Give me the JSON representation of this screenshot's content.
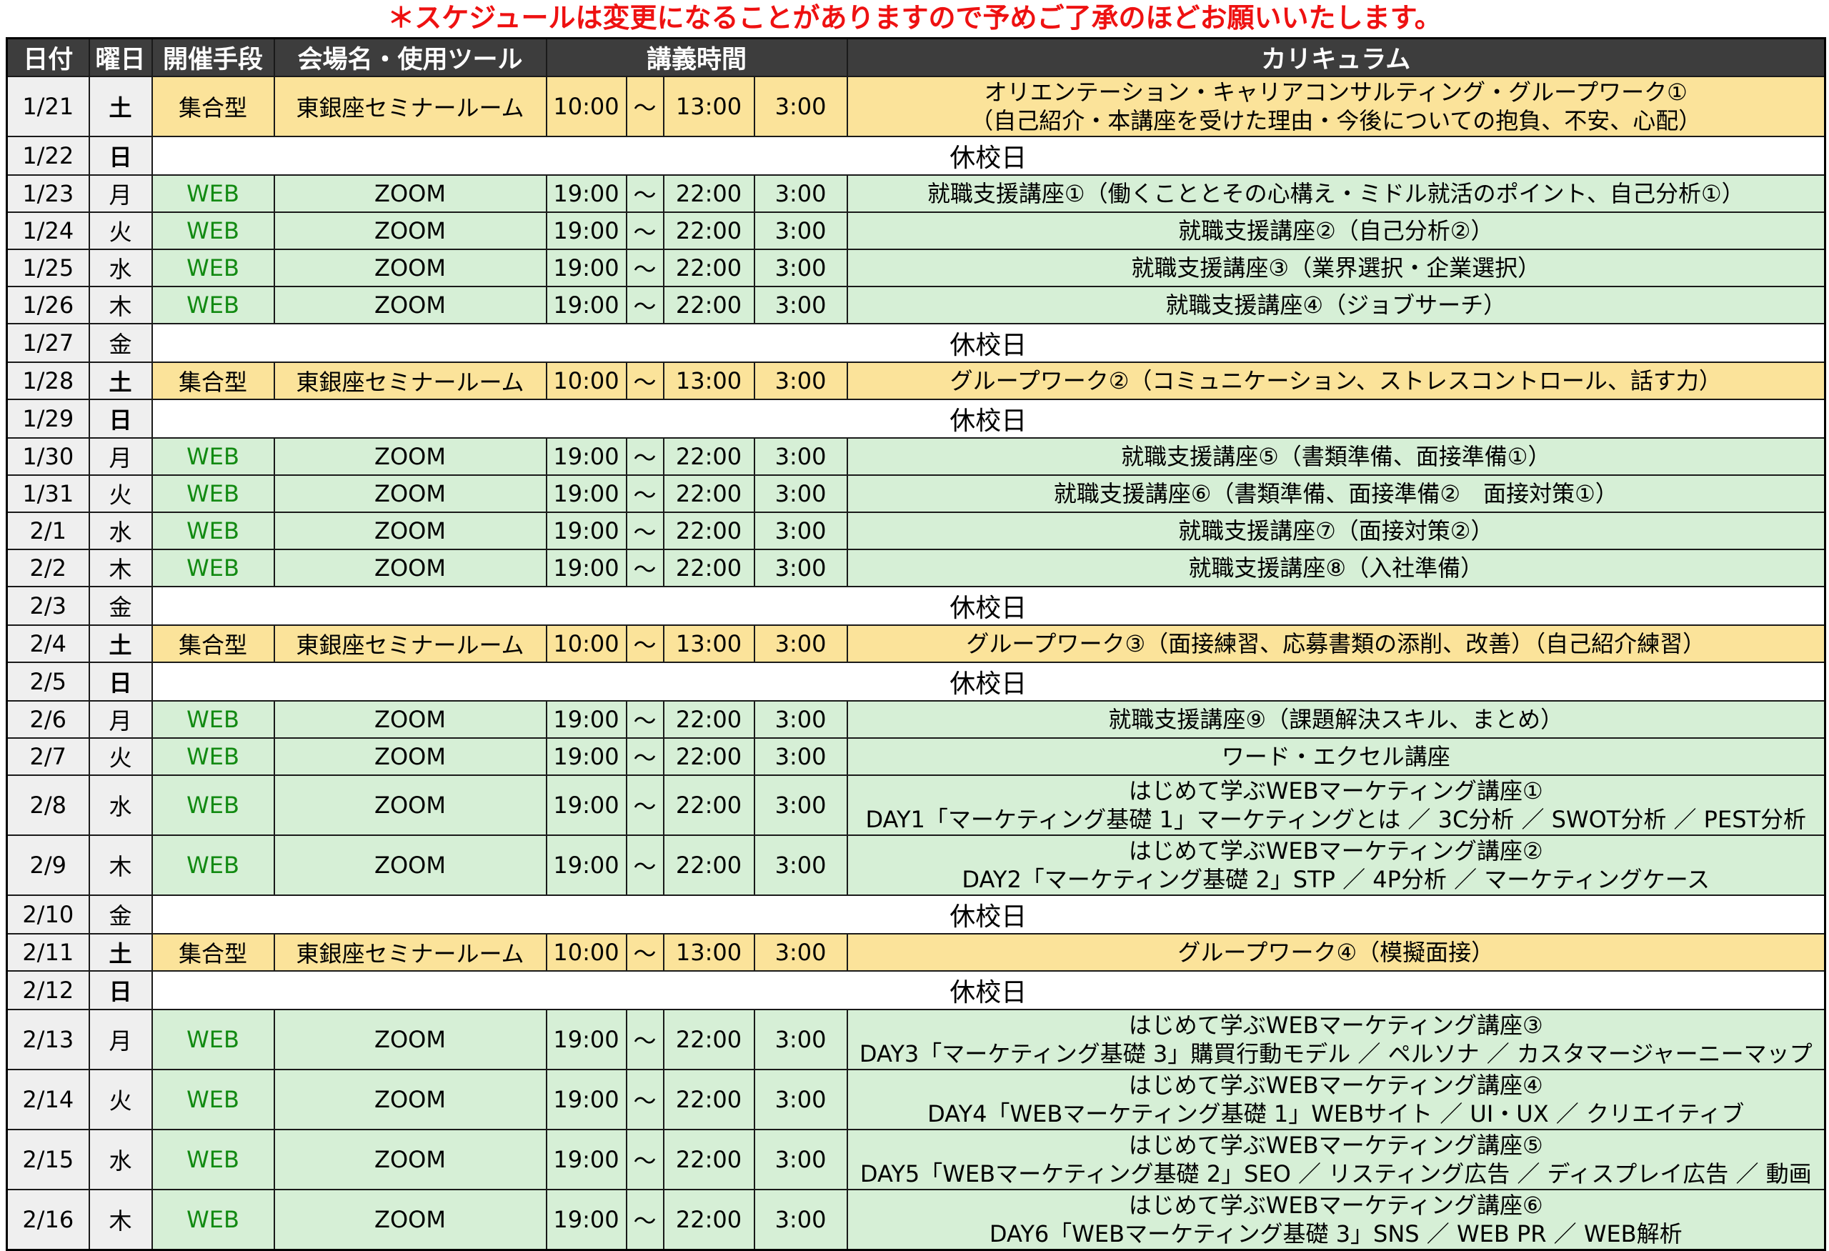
{
  "notice": "＊スケジュールは変更になることがありますので予めご了承のほどお願いいたします。",
  "headers": {
    "date": "日付",
    "day": "曜日",
    "method": "開催手段",
    "venue": "会場名・使用ツール",
    "time": "講義時間",
    "curriculum": "カリキュラム"
  },
  "holiday_label": "休校日",
  "rows": [
    {
      "date": "1/21",
      "day": "土",
      "kind": "live",
      "method": "集合型",
      "venue": "東銀座セミナールーム",
      "start": "10:00",
      "sep": "～",
      "end": "13:00",
      "dur": "3:00",
      "curriculum": [
        "オリエンテーション・キャリアコンサルティング・グループワーク①",
        "（自己紹介・本講座を受けた理由・今後についての抱負、不安、心配）"
      ],
      "color": "black"
    },
    {
      "date": "1/22",
      "day": "日",
      "kind": "holiday"
    },
    {
      "date": "1/23",
      "day": "月",
      "kind": "web",
      "method": "WEB",
      "venue": "ZOOM",
      "start": "19:00",
      "sep": "～",
      "end": "22:00",
      "dur": "3:00",
      "curriculum": [
        "就職支援講座①（働くこととその心構え・ミドル就活のポイント、自己分析①）"
      ],
      "color": "black"
    },
    {
      "date": "1/24",
      "day": "火",
      "kind": "web",
      "method": "WEB",
      "venue": "ZOOM",
      "start": "19:00",
      "sep": "～",
      "end": "22:00",
      "dur": "3:00",
      "curriculum": [
        "就職支援講座②（自己分析②）"
      ],
      "color": "black"
    },
    {
      "date": "1/25",
      "day": "水",
      "kind": "web",
      "method": "WEB",
      "venue": "ZOOM",
      "start": "19:00",
      "sep": "～",
      "end": "22:00",
      "dur": "3:00",
      "curriculum": [
        "就職支援講座③（業界選択・企業選択）"
      ],
      "color": "black"
    },
    {
      "date": "1/26",
      "day": "木",
      "kind": "web",
      "method": "WEB",
      "venue": "ZOOM",
      "start": "19:00",
      "sep": "～",
      "end": "22:00",
      "dur": "3:00",
      "curriculum": [
        "就職支援講座④（ジョブサーチ）"
      ],
      "color": "black"
    },
    {
      "date": "1/27",
      "day": "金",
      "kind": "holiday"
    },
    {
      "date": "1/28",
      "day": "土",
      "kind": "live",
      "method": "集合型",
      "venue": "東銀座セミナールーム",
      "start": "10:00",
      "sep": "～",
      "end": "13:00",
      "dur": "3:00",
      "curriculum": [
        "グループワーク②（コミュニケーション、ストレスコントロール、話す力）"
      ],
      "color": "black"
    },
    {
      "date": "1/29",
      "day": "日",
      "kind": "holiday"
    },
    {
      "date": "1/30",
      "day": "月",
      "kind": "web",
      "method": "WEB",
      "venue": "ZOOM",
      "start": "19:00",
      "sep": "～",
      "end": "22:00",
      "dur": "3:00",
      "curriculum": [
        "就職支援講座⑤（書類準備、面接準備①）"
      ],
      "color": "black"
    },
    {
      "date": "1/31",
      "day": "火",
      "kind": "web",
      "method": "WEB",
      "venue": "ZOOM",
      "start": "19:00",
      "sep": "～",
      "end": "22:00",
      "dur": "3:00",
      "curriculum": [
        "就職支援講座⑥（書類準備、面接準備②　面接対策①）"
      ],
      "color": "black"
    },
    {
      "date": "2/1",
      "day": "水",
      "kind": "web",
      "method": "WEB",
      "venue": "ZOOM",
      "start": "19:00",
      "sep": "～",
      "end": "22:00",
      "dur": "3:00",
      "curriculum": [
        "就職支援講座⑦（面接対策②）"
      ],
      "color": "black"
    },
    {
      "date": "2/2",
      "day": "木",
      "kind": "web",
      "method": "WEB",
      "venue": "ZOOM",
      "start": "19:00",
      "sep": "～",
      "end": "22:00",
      "dur": "3:00",
      "curriculum": [
        "就職支援講座⑧（入社準備）"
      ],
      "color": "black"
    },
    {
      "date": "2/3",
      "day": "金",
      "kind": "holiday"
    },
    {
      "date": "2/4",
      "day": "土",
      "kind": "live",
      "method": "集合型",
      "venue": "東銀座セミナールーム",
      "start": "10:00",
      "sep": "～",
      "end": "13:00",
      "dur": "3:00",
      "curriculum": [
        "グループワーク③（面接練習、応募書類の添削、改善）（自己紹介練習）"
      ],
      "color": "black"
    },
    {
      "date": "2/5",
      "day": "日",
      "kind": "holiday"
    },
    {
      "date": "2/6",
      "day": "月",
      "kind": "web",
      "method": "WEB",
      "venue": "ZOOM",
      "start": "19:00",
      "sep": "～",
      "end": "22:00",
      "dur": "3:00",
      "curriculum": [
        "就職支援講座⑨（課題解決スキル、まとめ）"
      ],
      "color": "black"
    },
    {
      "date": "2/7",
      "day": "火",
      "kind": "web",
      "method": "WEB",
      "venue": "ZOOM",
      "start": "19:00",
      "sep": "～",
      "end": "22:00",
      "dur": "3:00",
      "curriculum": [
        "ワード・エクセル講座"
      ],
      "color": "red"
    },
    {
      "date": "2/8",
      "day": "水",
      "kind": "web",
      "method": "WEB",
      "venue": "ZOOM",
      "start": "19:00",
      "sep": "～",
      "end": "22:00",
      "dur": "3:00",
      "curriculum": [
        "はじめて学ぶWEBマーケティング講座①",
        "DAY1「マーケティング基礎 1」マーケティングとは ／ 3C分析 ／ SWOT分析 ／ PEST分析"
      ],
      "color": "blue"
    },
    {
      "date": "2/9",
      "day": "木",
      "kind": "web",
      "method": "WEB",
      "venue": "ZOOM",
      "start": "19:00",
      "sep": "～",
      "end": "22:00",
      "dur": "3:00",
      "curriculum": [
        "はじめて学ぶWEBマーケティング講座②",
        "DAY2「マーケティング基礎 2」STP ／ 4P分析 ／ マーケティングケース"
      ],
      "color": "blue"
    },
    {
      "date": "2/10",
      "day": "金",
      "kind": "holiday"
    },
    {
      "date": "2/11",
      "day": "土",
      "kind": "live",
      "method": "集合型",
      "venue": "東銀座セミナールーム",
      "start": "10:00",
      "sep": "～",
      "end": "13:00",
      "dur": "3:00",
      "curriculum": [
        "グループワーク④（模擬面接）"
      ],
      "color": "black"
    },
    {
      "date": "2/12",
      "day": "日",
      "kind": "holiday"
    },
    {
      "date": "2/13",
      "day": "月",
      "kind": "web",
      "method": "WEB",
      "venue": "ZOOM",
      "start": "19:00",
      "sep": "～",
      "end": "22:00",
      "dur": "3:00",
      "curriculum": [
        "はじめて学ぶWEBマーケティング講座③",
        "DAY3「マーケティング基礎 3」購買行動モデル ／ ペルソナ ／ カスタマージャーニーマップ"
      ],
      "color": "blue"
    },
    {
      "date": "2/14",
      "day": "火",
      "kind": "web",
      "method": "WEB",
      "venue": "ZOOM",
      "start": "19:00",
      "sep": "～",
      "end": "22:00",
      "dur": "3:00",
      "curriculum": [
        "はじめて学ぶWEBマーケティング講座④",
        "DAY4「WEBマーケティング基礎 1」WEBサイト ／ UI・UX ／ クリエイティブ"
      ],
      "color": "blue"
    },
    {
      "date": "2/15",
      "day": "水",
      "kind": "web",
      "method": "WEB",
      "venue": "ZOOM",
      "start": "19:00",
      "sep": "～",
      "end": "22:00",
      "dur": "3:00",
      "curriculum": [
        "はじめて学ぶWEBマーケティング講座⑤",
        "DAY5「WEBマーケティング基礎 2」SEO ／ リスティング広告 ／ ディスプレイ広告 ／ 動画"
      ],
      "color": "blue"
    },
    {
      "date": "2/16",
      "day": "木",
      "kind": "web",
      "method": "WEB",
      "venue": "ZOOM",
      "start": "19:00",
      "sep": "～",
      "end": "22:00",
      "dur": "3:00",
      "curriculum": [
        "はじめて学ぶWEBマーケティング講座⑥",
        "DAY6「WEBマーケティング基礎 3」SNS ／ WEB PR ／ WEB解析"
      ],
      "color": "blue"
    }
  ]
}
